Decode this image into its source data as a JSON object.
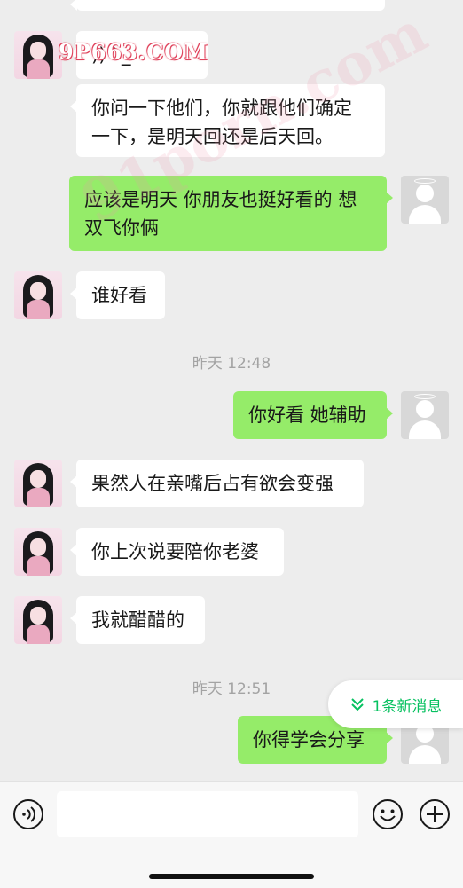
{
  "watermark": "9P663.COM",
  "watermark_large": "91porn.com",
  "messages": [
    {
      "side": "left",
      "text": "))^_"
    },
    {
      "side": "left",
      "text": "你问一下他们，你就跟他们确定一下，是明天回还是后天回。"
    },
    {
      "side": "right",
      "text": "应该是明天 你朋友也挺好看的 想双飞你俩"
    },
    {
      "side": "left",
      "text": "谁好看"
    },
    {
      "time": "昨天 12:48"
    },
    {
      "side": "right",
      "text": "你好看 她辅助"
    },
    {
      "side": "left",
      "text": "果然人在亲嘴后占有欲会变强"
    },
    {
      "side": "left",
      "text": "你上次说要陪你老婆"
    },
    {
      "side": "left",
      "text": "我就醋醋的"
    },
    {
      "time": "昨天 12:51"
    },
    {
      "side": "right",
      "text": "你得学会分享"
    }
  ],
  "new_message_pill": {
    "label": "1条新消息",
    "icon": "double-chevron-down-icon"
  },
  "toolbar": {
    "voice_icon": "voice-icon",
    "emoji_icon": "emoji-icon",
    "add_icon": "plus-icon",
    "input_value": ""
  },
  "colors": {
    "background": "#ededed",
    "bubble_me": "#95ec69",
    "bubble_other": "#ffffff",
    "accent": "#07c160"
  }
}
